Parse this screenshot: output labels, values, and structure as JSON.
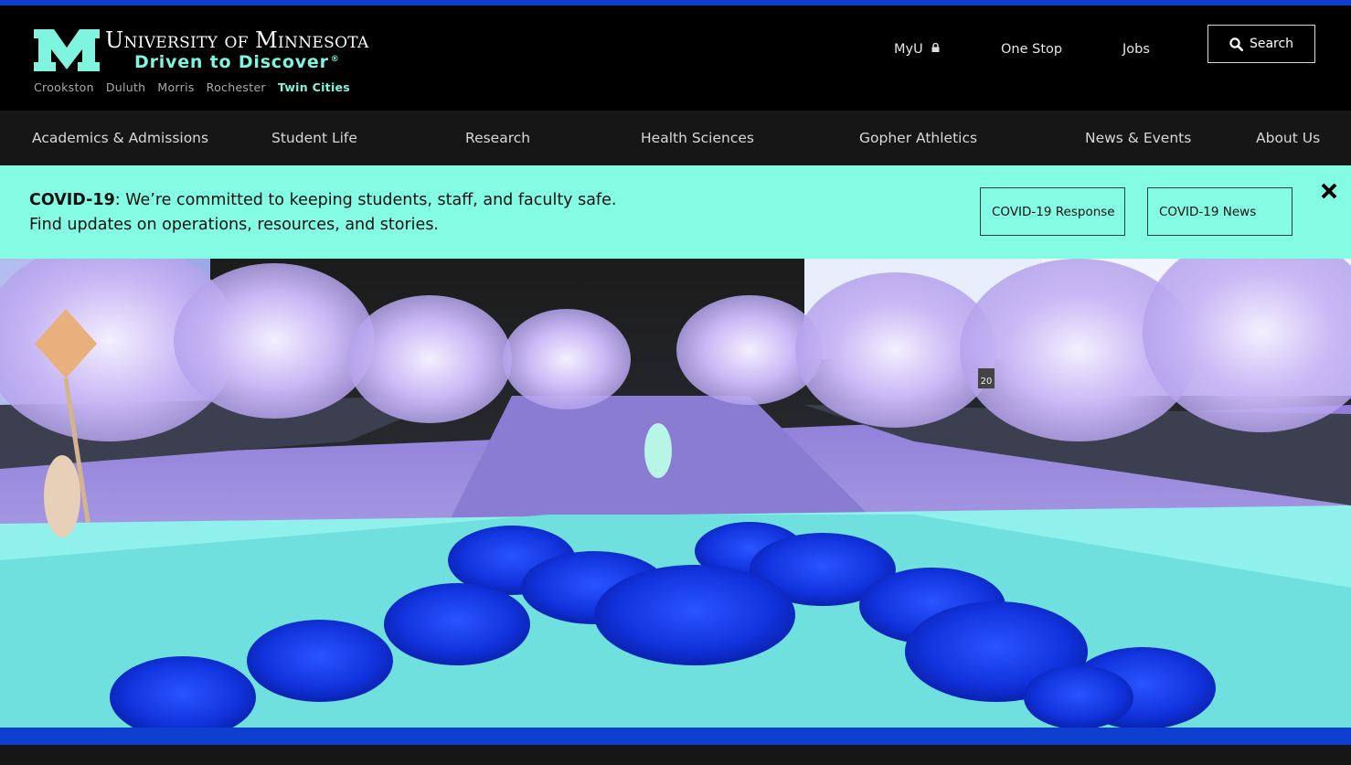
{
  "colors": {
    "accent": "#0f3fcf",
    "brand_teal": "#84fbe3",
    "header_bg": "#000000",
    "nav_bg": "#161616"
  },
  "header": {
    "logo_icon": "block-m-logo",
    "wordmark": {
      "u": "U",
      "niversity": "NIVERSITY",
      "of": "OF",
      "m": "M",
      "innesota": "INNESOTA"
    },
    "tagline": "Driven to Discover",
    "tagline_mark": "®",
    "campuses": [
      "Crookston",
      "Duluth",
      "Morris",
      "Rochester"
    ],
    "current_campus": "Twin Cities",
    "utility": {
      "myu": "MyU",
      "myu_icon": "lock-icon",
      "onestop": "One Stop",
      "jobs": "Jobs"
    },
    "search": {
      "label": "Search",
      "icon": "search-icon"
    }
  },
  "nav": {
    "items": [
      "Academics & Admissions",
      "Student Life",
      "Research",
      "Health Sciences",
      "Gopher Athletics",
      "News & Events",
      "About Us"
    ]
  },
  "alert": {
    "bold": "COVID-19",
    "line1": ": We’re committed to keeping students, staff, and faculty safe.",
    "line2": "Find updates on operations, resources, and stories.",
    "buttons": [
      "COVID-19 Response",
      "COVID-19 News"
    ],
    "close_icon": "close-icon"
  },
  "hero": {
    "image": "campus-mall-photo",
    "sign_text": "20"
  }
}
